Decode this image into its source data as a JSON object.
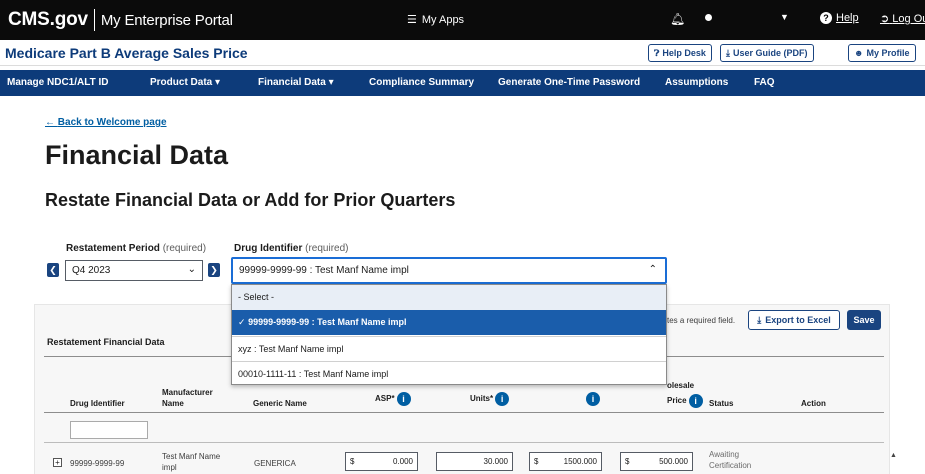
{
  "topbar": {
    "brand": "CMS.gov",
    "portal": "My Enterprise Portal",
    "my_apps": "My Apps",
    "help": "Help",
    "logout": "Log Out"
  },
  "app": {
    "title": "Medicare Part B Average Sales Price",
    "help_desk": "Help Desk",
    "user_guide": "User Guide (PDF)",
    "my_profile": "My Profile"
  },
  "nav": {
    "items": [
      "Manage NDC1/ALT ID",
      "Product Data",
      "Financial Data",
      "Compliance Summary",
      "Generate One-Time Password",
      "Assumptions",
      "FAQ"
    ]
  },
  "page": {
    "back_link": "Back to Welcome page",
    "title": "Financial Data",
    "subtitle": "Restate Financial Data or Add for Prior Quarters"
  },
  "filters": {
    "restatement_label": "Restatement Period",
    "restatement_req": "(required)",
    "restatement_value": "Q4 2023",
    "drug_label": "Drug Identifier",
    "drug_req": "(required)",
    "drug_value": "99999-9999-99 : Test Manf Name impl",
    "drug_options": [
      "- Select -",
      "99999-9999-99 : Test Manf Name impl",
      "xyz : Test Manf Name impl",
      "00010-1111-11 : Test Manf Name impl"
    ]
  },
  "table": {
    "required_note": "tes a required field.",
    "export_label": "Export to Excel",
    "save_label": "Save",
    "title": "Restatement Financial Data",
    "headers": {
      "drug_identifier": "Drug Identifier",
      "manufacturer_1": "Manufacturer",
      "manufacturer_2": "Name",
      "generic_name": "Generic Name",
      "asp": "ASP*",
      "units": "Units*",
      "wholesale_1": "olesale",
      "wholesale_2": "Price",
      "status": "Status",
      "action": "Action"
    },
    "row": {
      "drug_identifier": "99999-9999-99",
      "manufacturer_1": "Test Manf Name",
      "manufacturer_2": "impl",
      "generic_name": "GENERICA",
      "asp": "0.000",
      "units": "30.000",
      "col3": "1500.000",
      "wholesale": "500.000",
      "status_1": "Awaiting",
      "status_2": "Certification"
    },
    "currency_symbol": "$"
  },
  "colors": {
    "topbar": "#0b0b0b",
    "navbar": "#0d3b7a",
    "primary": "#1a4480",
    "link": "#005ea2",
    "selected_option": "#1a5dab"
  }
}
